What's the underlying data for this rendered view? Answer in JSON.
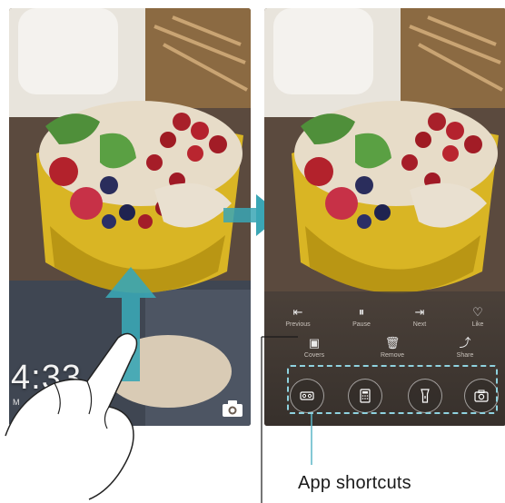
{
  "clock": {
    "time": "4:33",
    "date": "M"
  },
  "media_controls": [
    {
      "icon": "previous-icon",
      "glyph": "⇤",
      "label": "Previous"
    },
    {
      "icon": "pause-icon",
      "glyph": "⏸",
      "label": "Pause"
    },
    {
      "icon": "next-icon",
      "glyph": "⇥",
      "label": "Next"
    },
    {
      "icon": "like-icon",
      "glyph": "♡",
      "label": "Like"
    }
  ],
  "tool_controls": [
    {
      "icon": "covers-icon",
      "glyph": "▣",
      "label": "Covers"
    },
    {
      "icon": "remove-icon",
      "glyph": "🗑",
      "label": "Remove"
    },
    {
      "icon": "share-icon",
      "glyph": "⤴",
      "label": "Share"
    }
  ],
  "app_shortcuts": [
    {
      "icon": "voice-recorder-icon"
    },
    {
      "icon": "calculator-icon"
    },
    {
      "icon": "flashlight-icon"
    },
    {
      "icon": "camera-icon"
    }
  ],
  "callout": {
    "label": "App shortcuts"
  },
  "colors": {
    "accent": "#3aa6b5",
    "callout": "#8fd3e0",
    "bowl": "#d9b524"
  }
}
